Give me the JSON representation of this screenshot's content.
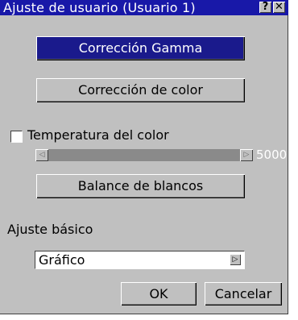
{
  "window": {
    "title": "Ajuste de usuario (Usuario 1)",
    "help_label": "?",
    "close_label": "✕"
  },
  "buttons": {
    "gamma": "Corrección Gamma",
    "color": "Corrección de color",
    "white_balance": "Balance de blancos",
    "ok": "OK",
    "cancel": "Cancelar"
  },
  "color_temperature": {
    "label": "Temperatura del color",
    "checked": false,
    "value": "5000",
    "left_arrow": "◁",
    "right_arrow": "▷"
  },
  "basic_adjust": {
    "label": "Ajuste básico",
    "selected": "Gráfico",
    "dropdown_arrow": "▷"
  },
  "colors": {
    "title_bar": "#1818a8",
    "selected_button": "#1a1a8c",
    "dialog_face": "#c0c0c0",
    "slider_track": "#8a8a8a"
  }
}
